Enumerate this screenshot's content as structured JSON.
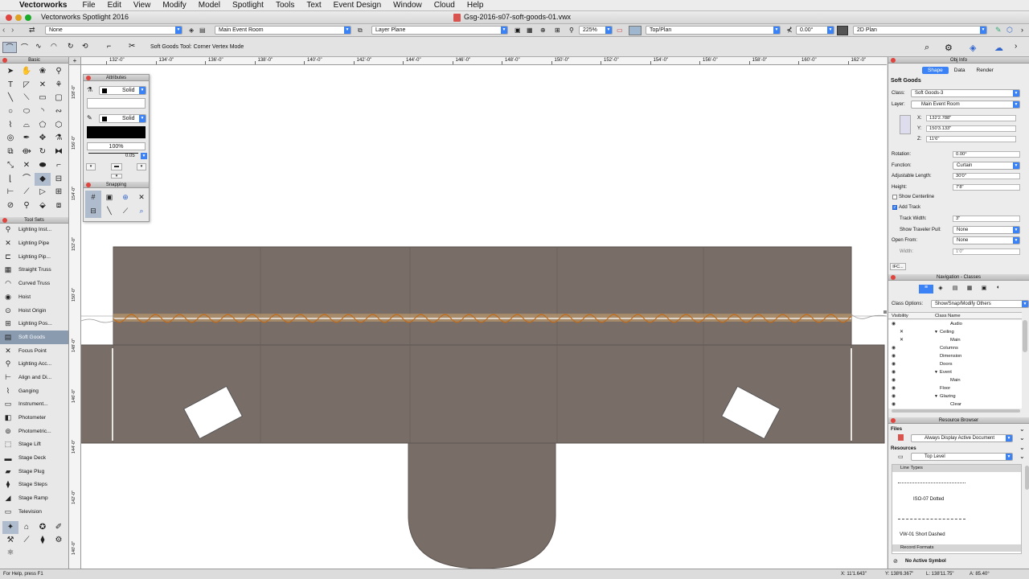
{
  "menubar": {
    "app": "Vectorworks",
    "items": [
      "File",
      "Edit",
      "View",
      "Modify",
      "Model",
      "Spotlight",
      "Tools",
      "Text",
      "Event Design",
      "Window",
      "Cloud",
      "Help"
    ]
  },
  "window": {
    "app_title": "Vectorworks Spotlight 2016",
    "doc_title": "Gsg-2016-s07-soft-goods-01.vwx"
  },
  "viewbar": {
    "class": "None",
    "layer": "Main Event Room",
    "plane": "Layer Plane",
    "zoom": "225%",
    "view": "Top/Plan",
    "rotation": "0.00°",
    "render_mode": "2D Plan"
  },
  "modebar": {
    "help_text": "Soft Goods Tool: Corner Vertex Mode"
  },
  "rulers": {
    "top": [
      "132'-0\"",
      "134'-0\"",
      "136'-0\"",
      "138'-0\"",
      "140'-0\"",
      "142'-0\"",
      "144'-0\"",
      "146'-0\"",
      "148'-0\"",
      "150'-0\"",
      "152'-0\"",
      "154'-0\"",
      "156'-0\"",
      "158'-0\"",
      "160'-0\"",
      "162'-0\""
    ],
    "left": [
      "158'-0\"",
      "156'-0\"",
      "154'-0\"",
      "152'-0\"",
      "150'-0\"",
      "148'-0\"",
      "146'-0\"",
      "144'-0\"",
      "142'-0\"",
      "140'-0\""
    ]
  },
  "basic_palette": {
    "title": "Basic"
  },
  "tool_sets": {
    "title": "Tool Sets",
    "items": [
      {
        "label": "Lighting Inst...",
        "icon": "lighting-instrument-icon"
      },
      {
        "label": "Lighting Pipe",
        "icon": "lighting-pipe-icon"
      },
      {
        "label": "Lighting Pip...",
        "icon": "lighting-pipe-ladder-icon"
      },
      {
        "label": "Straight Truss",
        "icon": "straight-truss-icon"
      },
      {
        "label": "Curved Truss",
        "icon": "curved-truss-icon"
      },
      {
        "label": "Hoist",
        "icon": "hoist-icon"
      },
      {
        "label": "Hoist Origin",
        "icon": "hoist-origin-icon"
      },
      {
        "label": "Lighting Pos...",
        "icon": "lighting-position-icon"
      },
      {
        "label": "Soft Goods",
        "icon": "soft-goods-icon"
      },
      {
        "label": "Focus Point",
        "icon": "focus-point-icon"
      },
      {
        "label": "Lighting Acc...",
        "icon": "lighting-accessory-icon"
      },
      {
        "label": "Align and Di...",
        "icon": "align-distribute-icon"
      },
      {
        "label": "Ganging",
        "icon": "ganging-icon"
      },
      {
        "label": "Instrument...",
        "icon": "instrument-icon"
      },
      {
        "label": "Photometer",
        "icon": "photometer-icon"
      },
      {
        "label": "Photometric...",
        "icon": "photometric-icon"
      },
      {
        "label": "Stage Lift",
        "icon": "stage-lift-icon"
      },
      {
        "label": "Stage Deck",
        "icon": "stage-deck-icon"
      },
      {
        "label": "Stage Plug",
        "icon": "stage-plug-icon"
      },
      {
        "label": "Stage Steps",
        "icon": "stage-steps-icon"
      },
      {
        "label": "Stage Ramp",
        "icon": "stage-ramp-icon"
      },
      {
        "label": "Television",
        "icon": "television-icon"
      }
    ]
  },
  "attributes": {
    "title": "Attributes",
    "fill_style": "Solid",
    "pen_style": "Solid",
    "opacity": "100%",
    "line_weight": "0.05",
    "snapping_title": "Snapping"
  },
  "obj_info": {
    "title": "Obj Info",
    "tabs": [
      "Shape",
      "Data",
      "Render"
    ],
    "object_type": "Soft Goods",
    "class_label": "Class:",
    "class_value": "Soft Goods-3",
    "layer_label": "Layer:",
    "layer_value": "Main Event Room",
    "x_label": "X:",
    "x_value": "132'2.788\"",
    "y_label": "Y:",
    "y_value": "150'3.133\"",
    "z_label": "Z:",
    "z_value": "11'6\"",
    "rotation_label": "Rotation:",
    "rotation_value": "0.00°",
    "function_label": "Function:",
    "function_value": "Curtain",
    "adjlen_label": "Adjustable Length:",
    "adjlen_value": "30'0\"",
    "height_label": "Height:",
    "height_value": "7'8\"",
    "show_centerline": "Show Centerline",
    "add_track": "Add Track",
    "track_width_label": "Track Width:",
    "track_width_value": "3\"",
    "traveler_label": "Show Traveler Pull:",
    "traveler_value": "None",
    "open_from_label": "Open From:",
    "open_from_value": "None",
    "width_label": "Width:",
    "width_value": "1'0\"",
    "ifc_button": "IFC..."
  },
  "navigation": {
    "title": "Navigation - Classes",
    "class_options_label": "Class Options:",
    "class_options_value": "Show/Snap/Modify Others",
    "col_visibility": "Visibility",
    "col_class_name": "Class Name",
    "rows": [
      {
        "name": "Audio",
        "indent": 2,
        "vis": "eye"
      },
      {
        "name": "Ceiling",
        "indent": 1,
        "vis": "x",
        "expander": "▼"
      },
      {
        "name": "Main",
        "indent": 2,
        "vis": "x"
      },
      {
        "name": "Columns",
        "indent": 1,
        "vis": "eye"
      },
      {
        "name": "Dimension",
        "indent": 1,
        "vis": "eye"
      },
      {
        "name": "Doors",
        "indent": 1,
        "vis": "eye"
      },
      {
        "name": "Event",
        "indent": 1,
        "vis": "eye",
        "expander": "▼"
      },
      {
        "name": "Main",
        "indent": 2,
        "vis": "eye"
      },
      {
        "name": "Floor",
        "indent": 1,
        "vis": "eye"
      },
      {
        "name": "Glazing",
        "indent": 1,
        "vis": "eye",
        "expander": "▼"
      },
      {
        "name": "Clear",
        "indent": 2,
        "vis": "eye"
      }
    ]
  },
  "resource_browser": {
    "title": "Resource Browser",
    "files_label": "Files",
    "files_value": "Always Display Active Document",
    "resources_label": "Resources",
    "resources_value": "Top Level",
    "group_line_types": "Line Types",
    "line_type_1": "ISO-07 Dotted",
    "line_type_2": "VW-01 Short Dashed",
    "group_record_formats": "Record Formats",
    "no_symbol": "No Active Symbol"
  },
  "statusbar": {
    "help": "For Help, press F1",
    "x": "X: 11'1.643\"",
    "y": "Y: 138'6.367\"",
    "l": "L: 138'11.75\"",
    "a": "A: 85.40°"
  }
}
